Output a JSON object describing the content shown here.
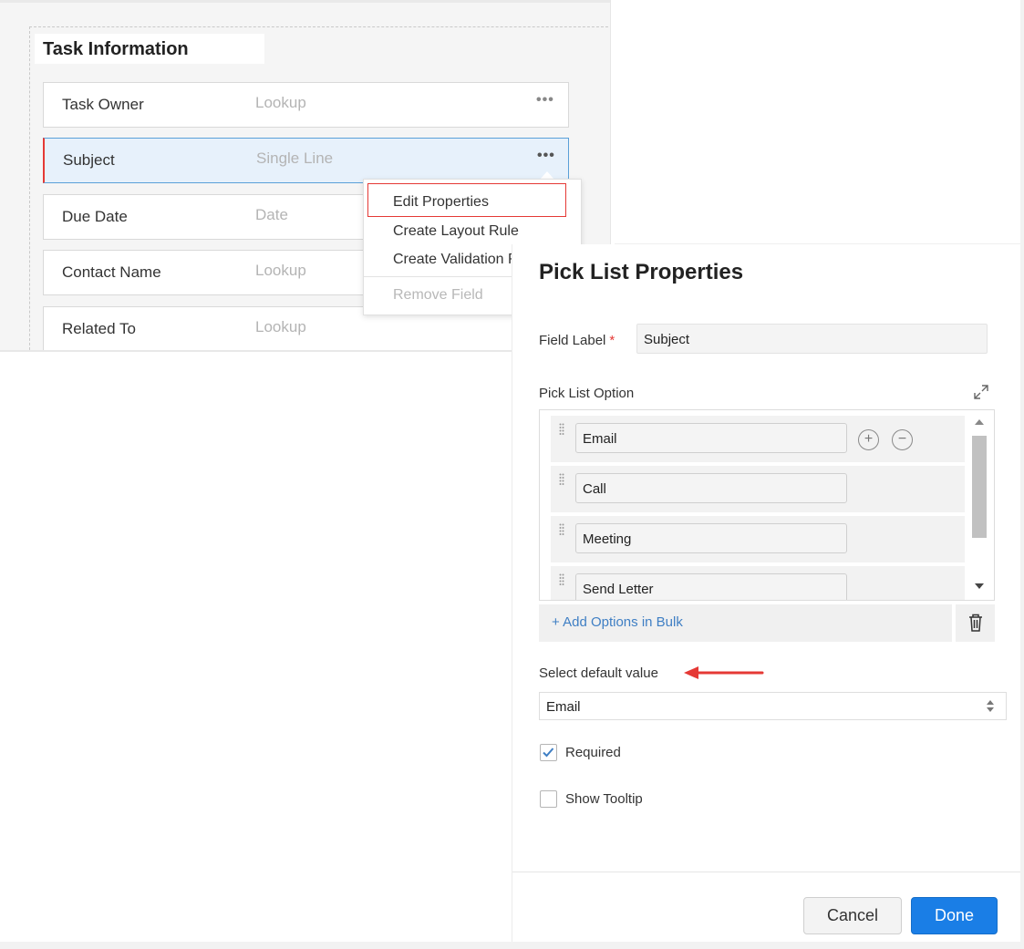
{
  "layout_editor": {
    "section_title": "Task Information",
    "fields": [
      {
        "label": "Task Owner",
        "type": "Lookup"
      },
      {
        "label": "Subject",
        "type": "Single Line"
      },
      {
        "label": "Due Date",
        "type": "Date"
      },
      {
        "label": "Contact Name",
        "type": "Lookup"
      },
      {
        "label": "Related To",
        "type": "Lookup"
      }
    ],
    "more_glyph": "•••",
    "context_menu": {
      "items": [
        "Edit Properties",
        "Create Layout Rule",
        "Create Validation R"
      ],
      "disabled_item": "Remove Field"
    }
  },
  "panel": {
    "title": "Pick List Properties",
    "field_label": {
      "label": "Field Label",
      "required_mark": "*",
      "value": "Subject"
    },
    "pick_list": {
      "label": "Pick List Option",
      "options": [
        "Email",
        "Call",
        "Meeting",
        "Send Letter"
      ],
      "add_glyph": "+",
      "remove_glyph": "−",
      "add_bulk_label": "+ Add Options in Bulk"
    },
    "default_value": {
      "label": "Select default value",
      "value": "Email"
    },
    "required": {
      "label": "Required",
      "checked": true
    },
    "show_tooltip": {
      "label": "Show Tooltip",
      "checked": false
    },
    "buttons": {
      "cancel": "Cancel",
      "done": "Done"
    }
  },
  "colors": {
    "accent_blue": "#1a7ee6",
    "link_blue": "#3f7fc4",
    "highlight_red": "#e53935"
  }
}
